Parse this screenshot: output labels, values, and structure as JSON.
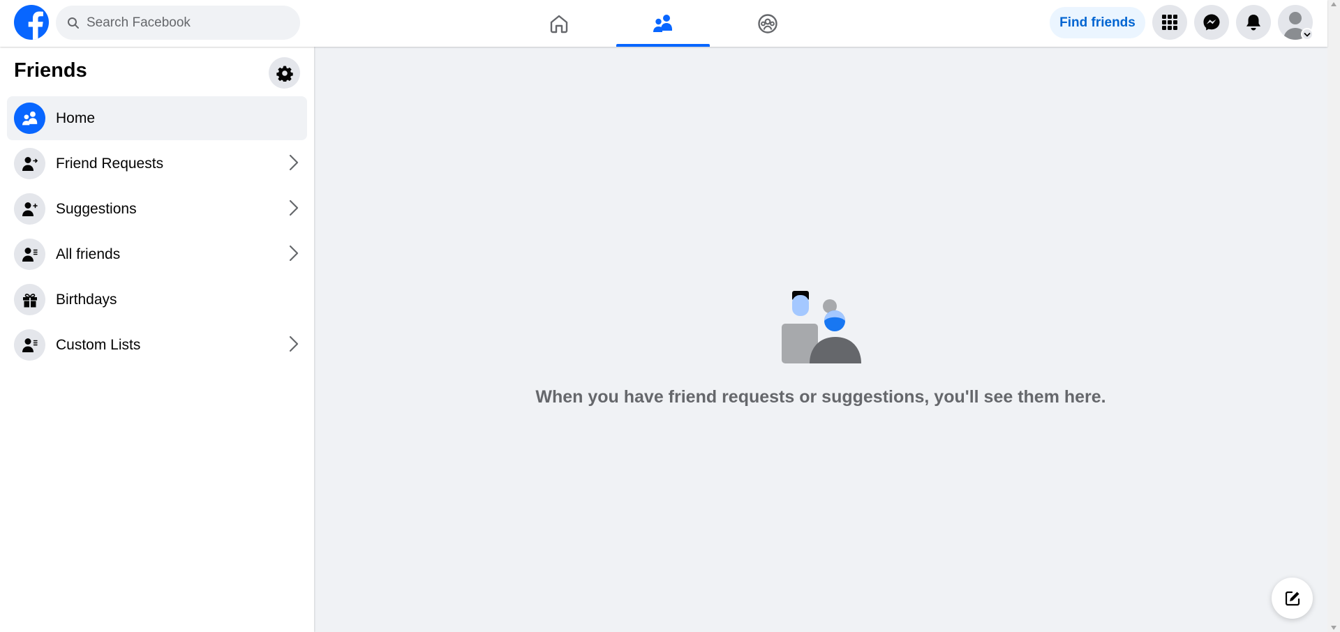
{
  "app": {
    "brand_color": "#0866ff",
    "logo_icon": "facebook-logo-icon"
  },
  "search": {
    "placeholder": "Search Facebook",
    "value": "",
    "icon": "search-icon"
  },
  "nav": {
    "tabs": [
      {
        "name": "home",
        "icon": "home-icon",
        "active": false
      },
      {
        "name": "friends",
        "icon": "friends-icon",
        "active": true
      },
      {
        "name": "groups",
        "icon": "groups-icon",
        "active": false
      }
    ]
  },
  "header_actions": {
    "find_friends_label": "Find friends",
    "menu_icon": "grid-menu-icon",
    "messenger_icon": "messenger-icon",
    "notifications_icon": "bell-icon",
    "account_icon": "avatar"
  },
  "sidebar": {
    "title": "Friends",
    "settings_icon": "gear-icon",
    "items": [
      {
        "label": "Home",
        "icon": "friends-home-icon",
        "active": true,
        "has_chevron": false
      },
      {
        "label": "Friend Requests",
        "icon": "friend-requests-icon",
        "active": false,
        "has_chevron": true
      },
      {
        "label": "Suggestions",
        "icon": "suggestions-icon",
        "active": false,
        "has_chevron": true
      },
      {
        "label": "All friends",
        "icon": "all-friends-icon",
        "active": false,
        "has_chevron": true
      },
      {
        "label": "Birthdays",
        "icon": "gift-icon",
        "active": false,
        "has_chevron": false
      },
      {
        "label": "Custom Lists",
        "icon": "custom-lists-icon",
        "active": false,
        "has_chevron": true
      }
    ]
  },
  "main": {
    "empty_message": "When you have friend requests or suggestions, you'll see them here.",
    "illustration": "friends-empty-illustration"
  },
  "compose": {
    "icon": "compose-icon"
  },
  "colors": {
    "accent": "#0866ff",
    "page_bg": "#f0f2f5",
    "muted_text": "#65676b"
  }
}
